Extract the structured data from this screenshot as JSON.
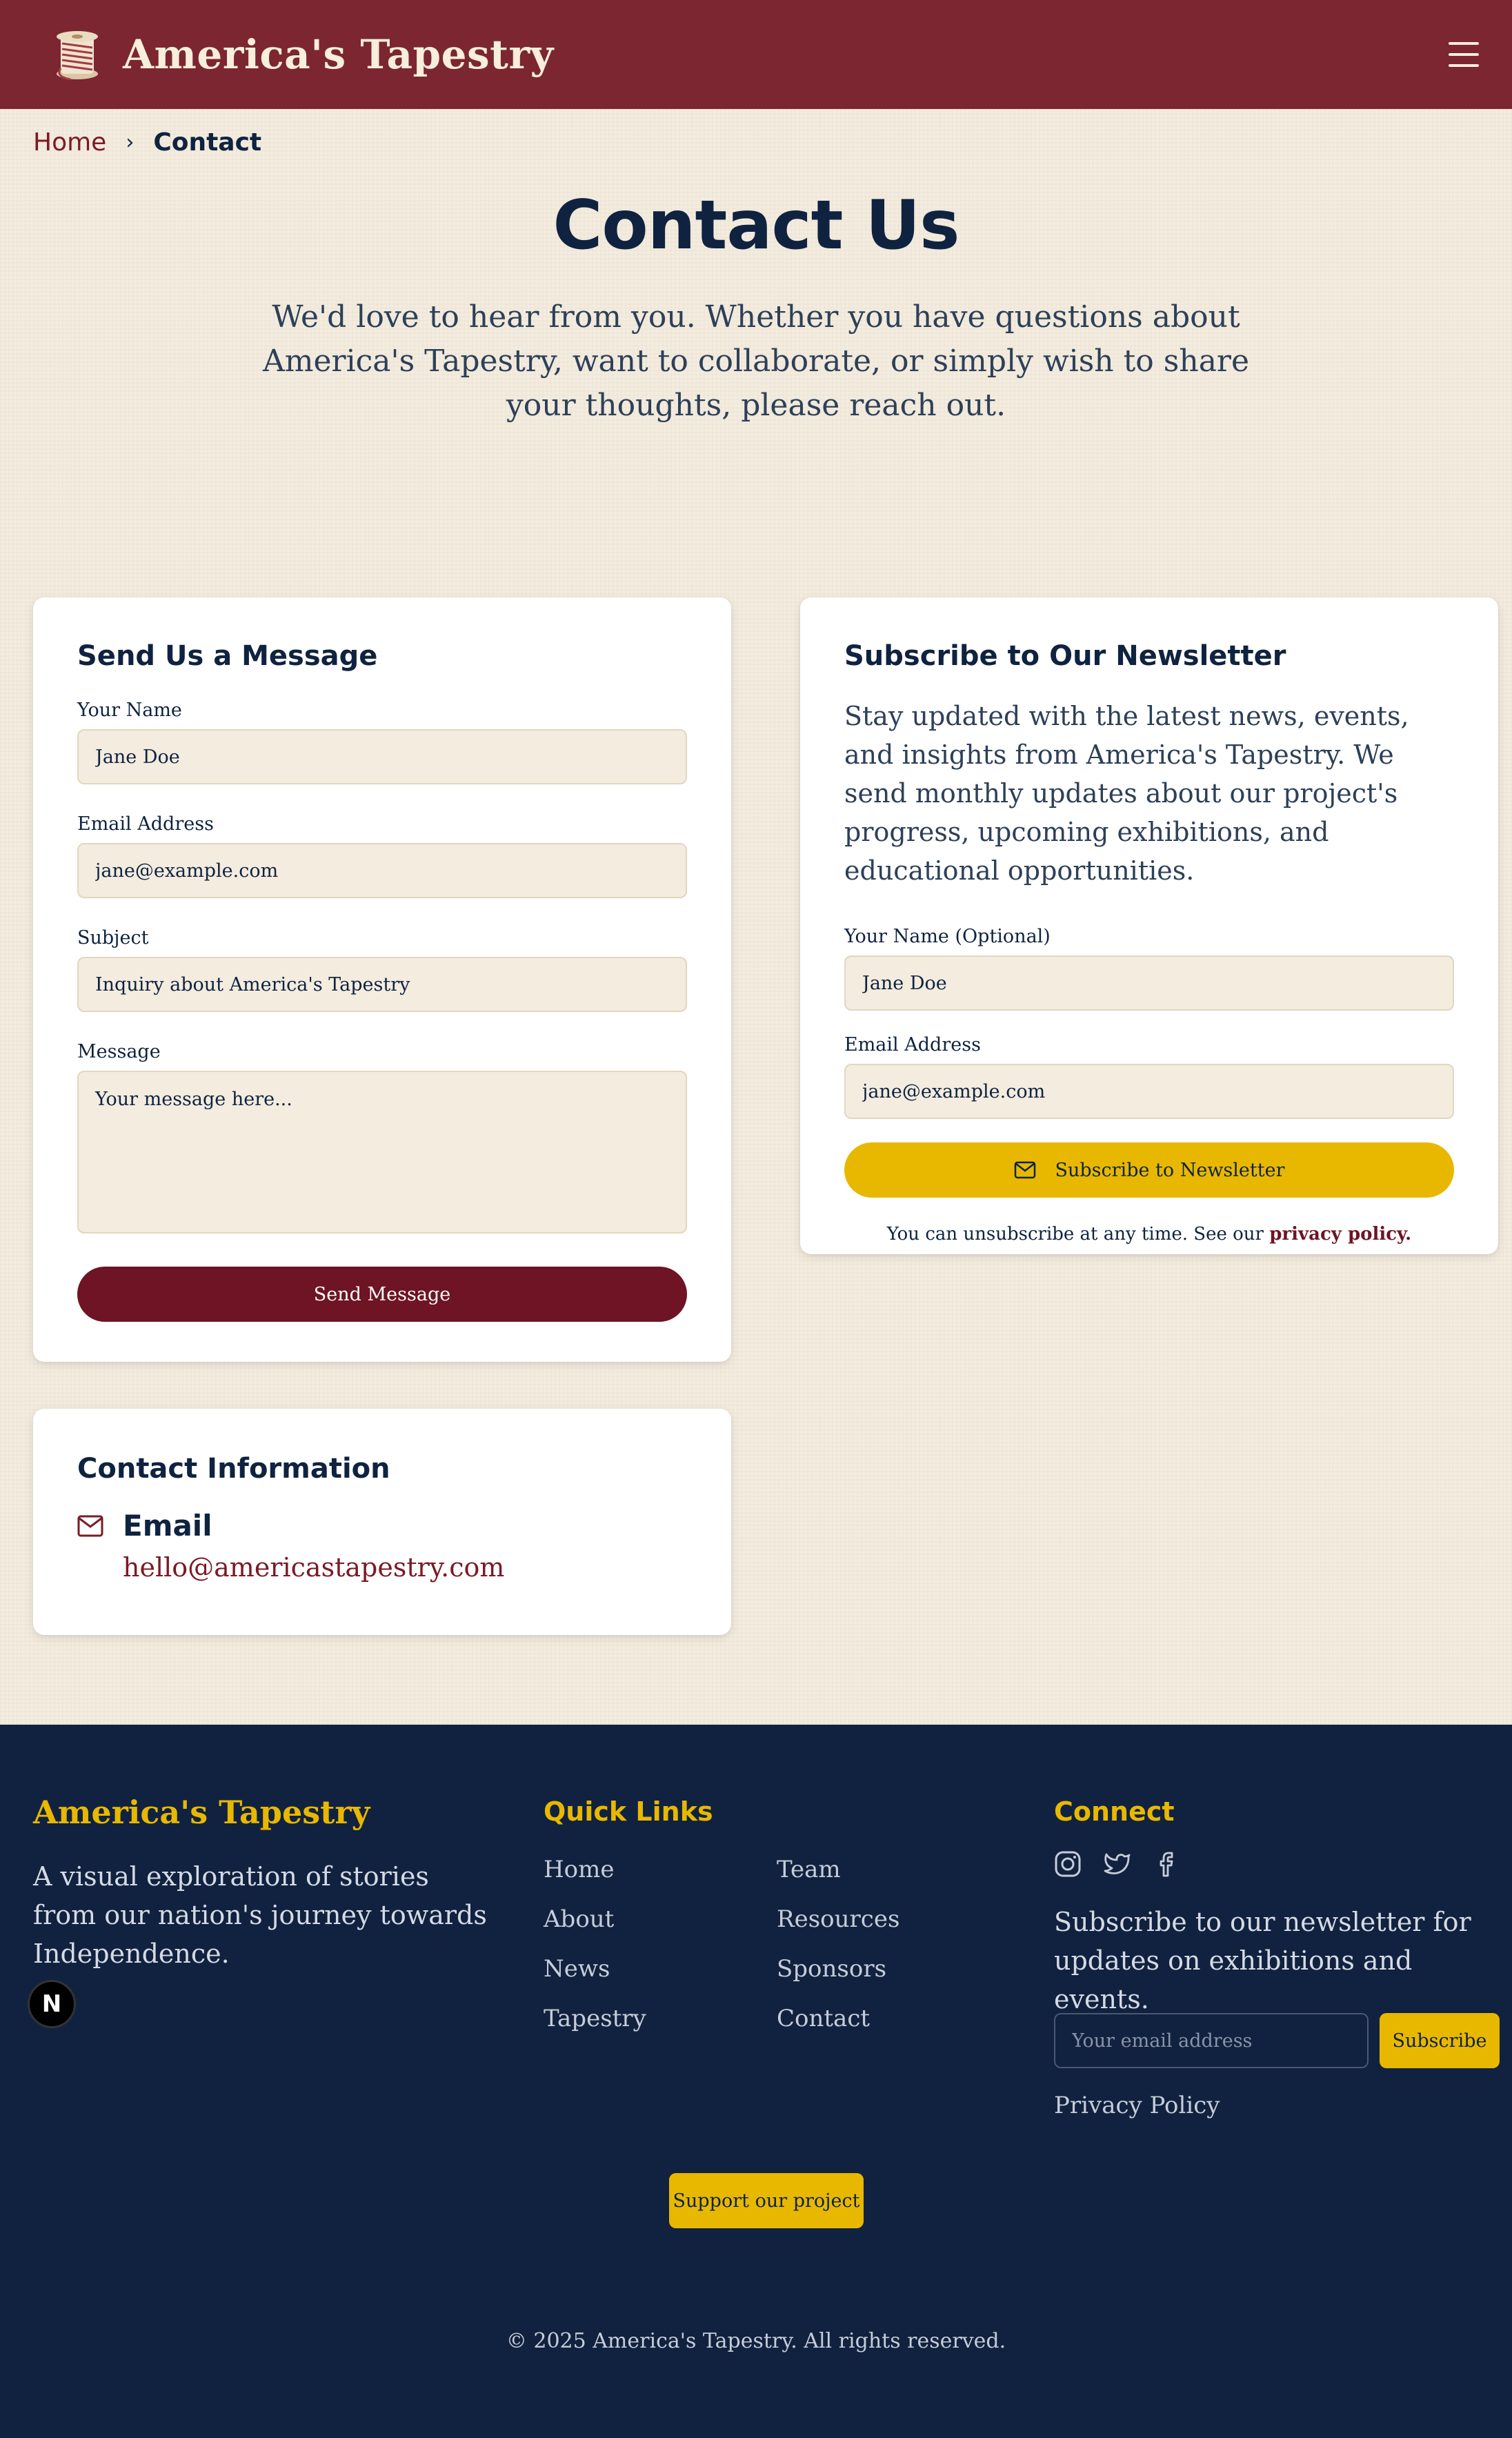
{
  "header": {
    "brand": "America's Tapestry"
  },
  "breadcrumb": {
    "home": "Home",
    "separator": "›",
    "current": "Contact"
  },
  "hero": {
    "title": "Contact Us",
    "subtitle": "We'd love to hear from you. Whether you have questions about America's Tapestry, want to collaborate, or simply wish to share your thoughts, please reach out."
  },
  "message_form": {
    "title": "Send Us a Message",
    "name_label": "Your Name",
    "name_placeholder": "Jane Doe",
    "email_label": "Email Address",
    "email_placeholder": "jane@example.com",
    "subject_label": "Subject",
    "subject_placeholder": "Inquiry about America's Tapestry",
    "message_label": "Message",
    "message_placeholder": "Your message here...",
    "submit_label": "Send Message"
  },
  "newsletter": {
    "title": "Subscribe to Our Newsletter",
    "description": "Stay updated with the latest news, events, and insights from America's Tapestry. We send monthly updates about our project's progress, upcoming exhibitions, and educational opportunities.",
    "name_label": "Your Name (Optional)",
    "name_placeholder": "Jane Doe",
    "email_label": "Email Address",
    "email_placeholder": "jane@example.com",
    "submit_label": "Subscribe to Newsletter",
    "fine_print": "You can unsubscribe at any time. See our",
    "privacy_link": "privacy policy."
  },
  "contact_info": {
    "title": "Contact Information",
    "email_heading": "Email",
    "email_value": "hello@americastapestry.com"
  },
  "footer": {
    "brand": "America's Tapestry",
    "description": "A visual exploration of stories from our nation's journey towards Independence.",
    "quick_links_title": "Quick Links",
    "links_col1": [
      "Home",
      "About",
      "News",
      "Tapestry"
    ],
    "links_col2": [
      "Team",
      "Resources",
      "Sponsors",
      "Contact"
    ],
    "connect_title": "Connect",
    "connect_description": "Subscribe to our newsletter for updates on exhibitions and events.",
    "email_placeholder": "Your email address",
    "subscribe_label": "Subscribe",
    "privacy_label": "Privacy Policy",
    "support_label": "Support our project",
    "copyright": "© 2025 America's Tapestry. All rights reserved."
  },
  "badge": {
    "letter": "N"
  },
  "icons": {
    "logo": "thread-spool-icon",
    "menu": "hamburger-menu-icon",
    "mail": "mail-icon",
    "social": [
      "instagram-icon",
      "twitter-icon",
      "facebook-icon"
    ]
  },
  "colors": {
    "header_bg": "#7b2630",
    "page_bg": "#f3ecdf",
    "maroon_button": "#6e1424",
    "accent_yellow": "#e8b800",
    "navy": "#0f2340",
    "footer_bg": "#112240"
  }
}
